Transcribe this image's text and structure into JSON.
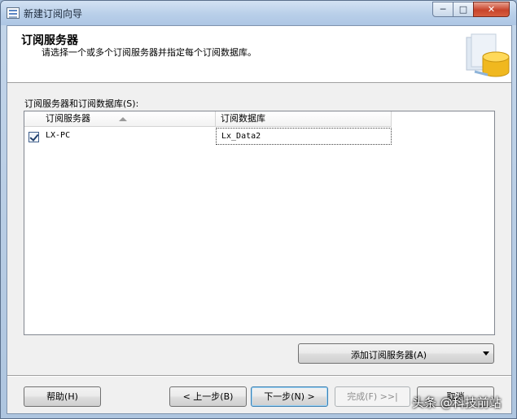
{
  "window": {
    "title": "新建订阅向导",
    "minimize_glyph": "─",
    "maximize_glyph": "□",
    "close_glyph": "✕"
  },
  "header": {
    "title": "订阅服务器",
    "description": "请选择一个或多个订阅服务器并指定每个订阅数据库。"
  },
  "grid": {
    "label": "订阅服务器和订阅数据库(S):",
    "columns": [
      "订阅服务器",
      "订阅数据库"
    ],
    "rows": [
      {
        "checked": true,
        "server": "LX-PC",
        "database": "Lx_Data2"
      }
    ]
  },
  "add_subscriber_button": "添加订阅服务器(A)",
  "footer": {
    "help": "帮助(H)",
    "back": "< 上一步(B)",
    "next": "下一步(N) >",
    "finish": "完成(F) >>|",
    "cancel": "取消"
  },
  "watermark": "头条 @科技前站",
  "colors": {
    "title_bar": "#c4d6ea",
    "close_button": "#c8442b",
    "dialog_bg": "#f0f0f0",
    "default_button_border": "#3c7fb1"
  }
}
